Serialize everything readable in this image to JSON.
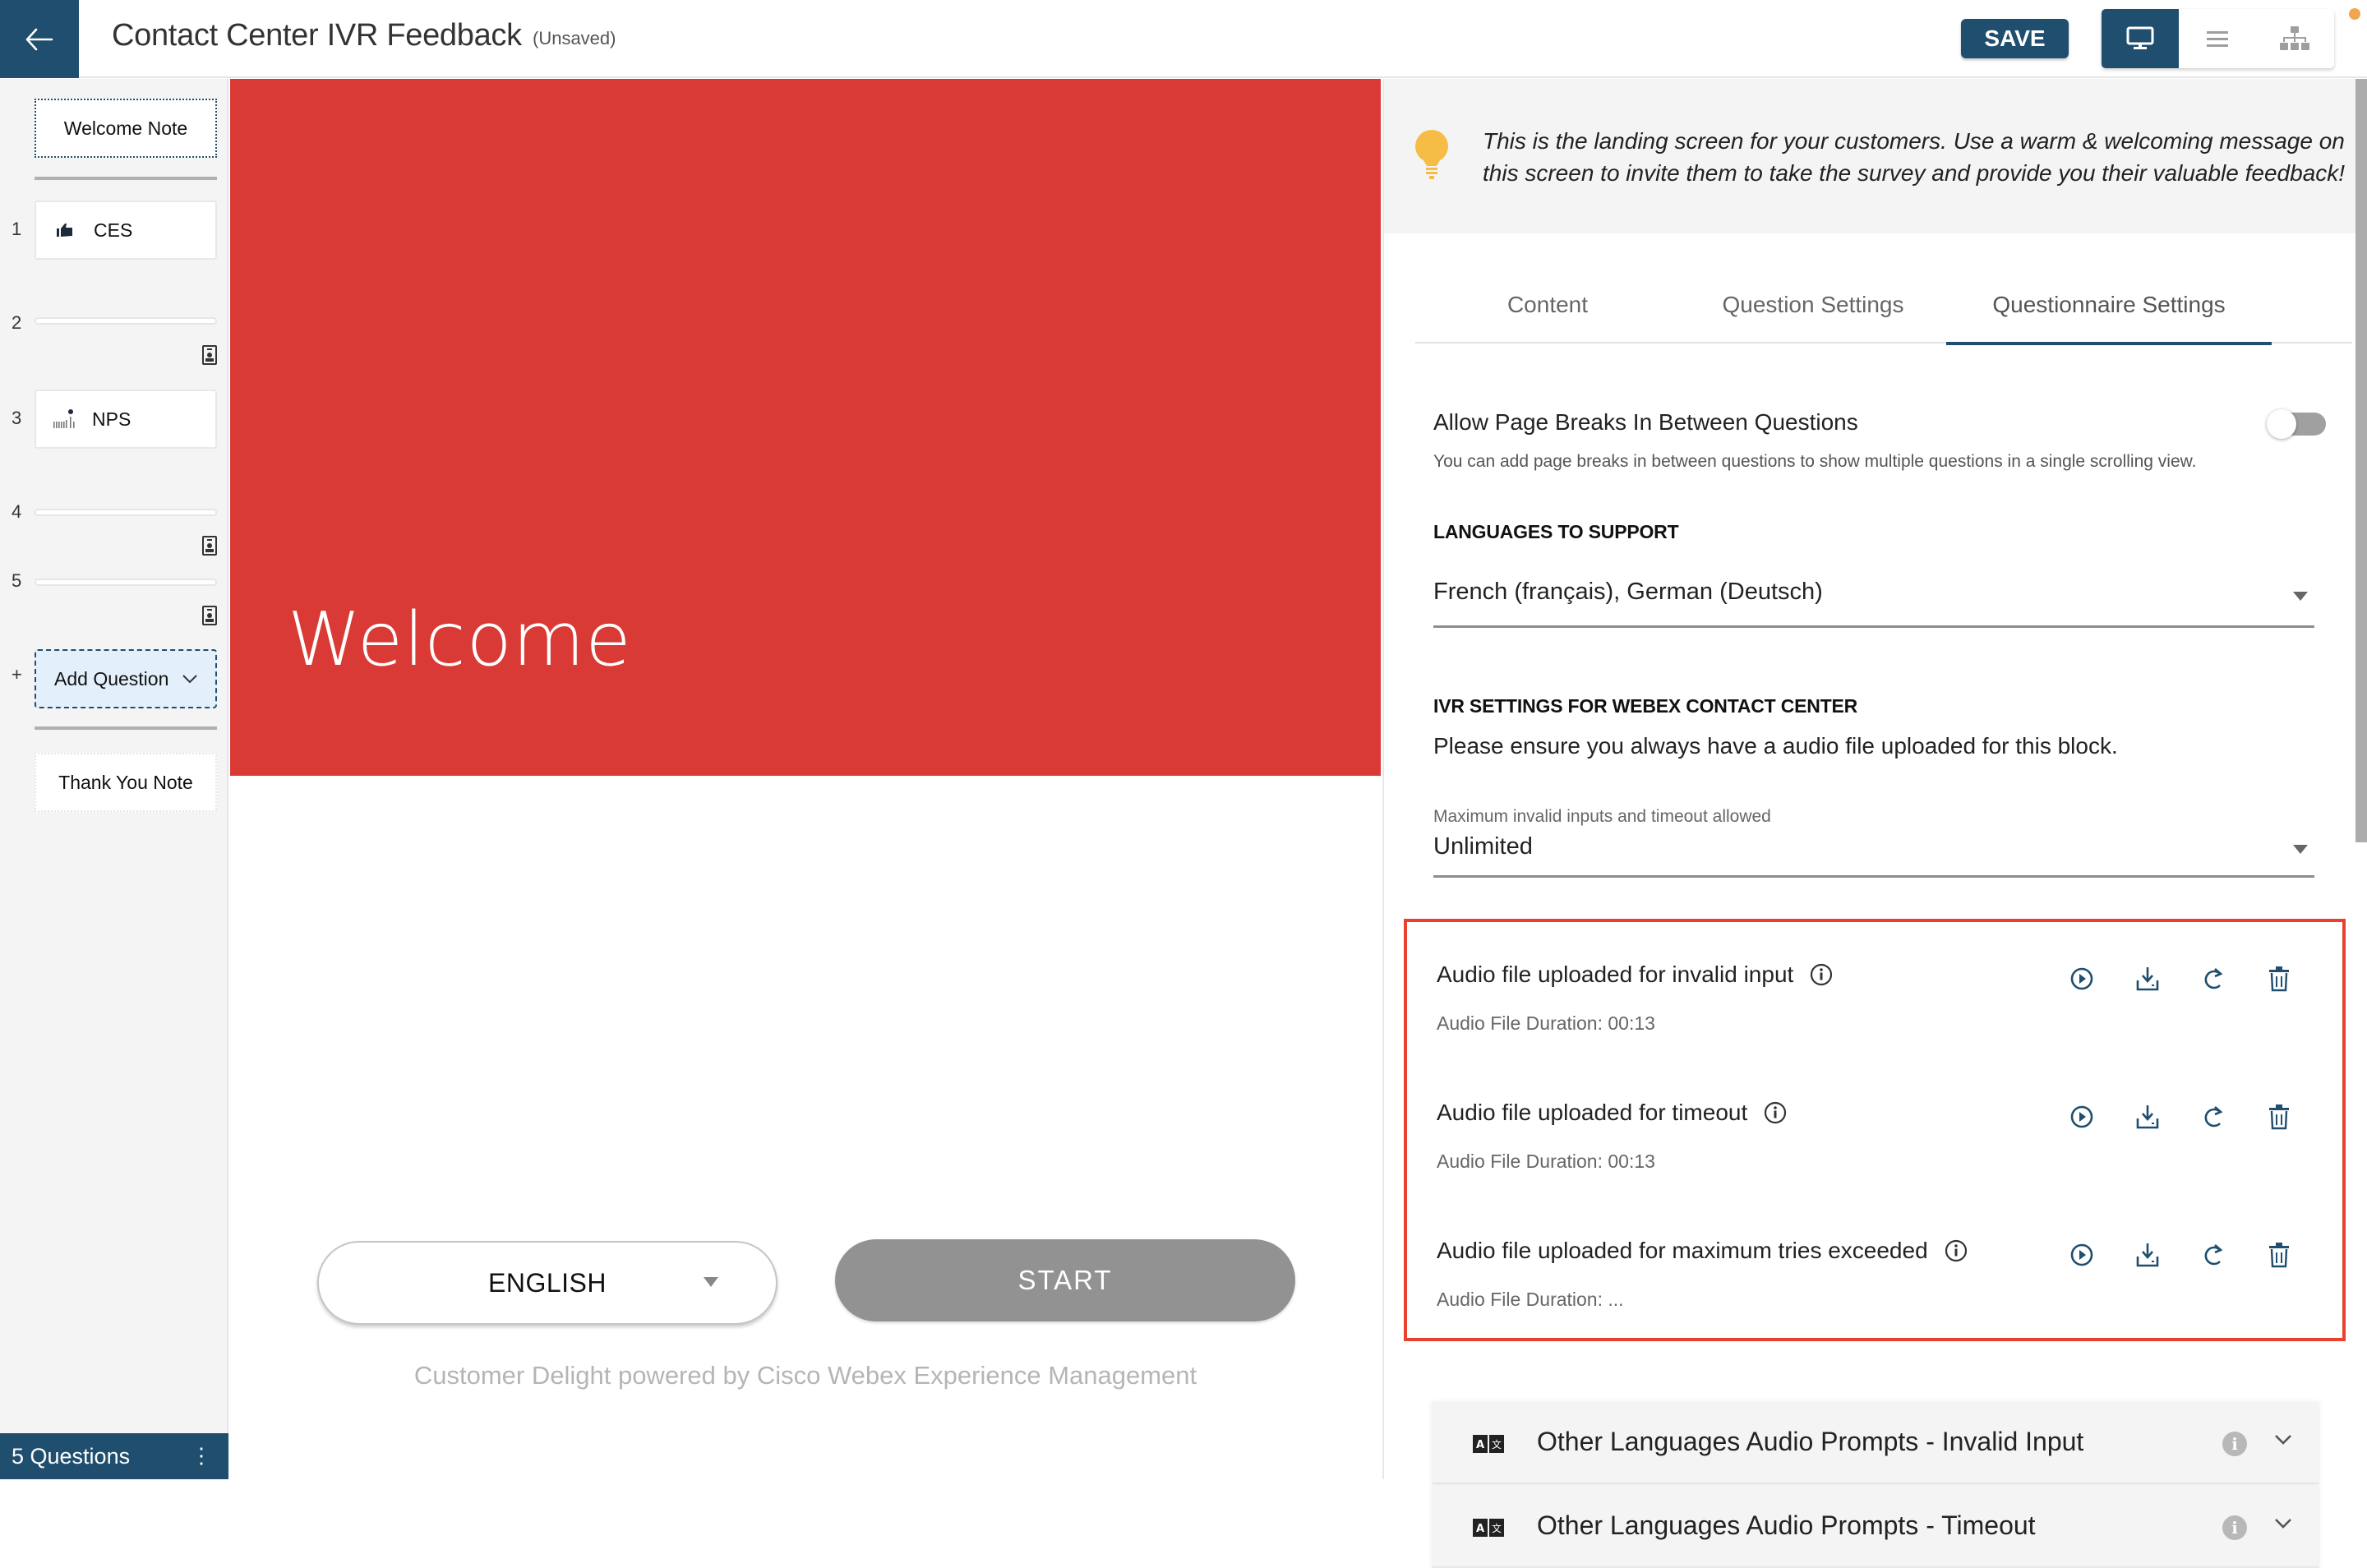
{
  "header": {
    "back_label": "Back",
    "title": "Contact Center IVR Feedback",
    "status": "(Unsaved)",
    "save_label": "SAVE",
    "views": [
      {
        "name": "desktop-preview",
        "icon": "monitor-icon",
        "active": true
      },
      {
        "name": "list-view",
        "icon": "list-icon",
        "active": false
      },
      {
        "name": "flow-view",
        "icon": "hierarchy-icon",
        "active": false
      }
    ]
  },
  "sidebar": {
    "welcome_note": "Welcome Note",
    "questions": [
      {
        "number": "1",
        "label": "CES",
        "icon": "thumbs-up-icon"
      },
      {
        "number": "2",
        "label": "",
        "icon": "contact-card-icon"
      },
      {
        "number": "3",
        "label": "NPS",
        "icon": "nps-icon"
      },
      {
        "number": "4",
        "label": "",
        "icon": "contact-card-icon"
      },
      {
        "number": "5",
        "label": "",
        "icon": "contact-card-icon"
      }
    ],
    "add_prefix": "+",
    "add_question": "Add Question",
    "thank_you_note": "Thank You Note",
    "footer": "5 Questions",
    "footer_menu": "⋮"
  },
  "preview": {
    "hero_color": "#d93a35",
    "welcome_title": "Welcome",
    "language": "ENGLISH",
    "start_label": "START",
    "powered_by": "Customer Delight powered by Cisco Webex Experience Management"
  },
  "panel": {
    "tip": "This is the landing screen for your customers. Use a warm & welcoming message on this screen to invite them to take the survey and provide you their valuable feedback!",
    "tabs": [
      {
        "label": "Content",
        "active": false
      },
      {
        "label": "Question Settings",
        "active": false
      },
      {
        "label": "Questionnaire Settings",
        "active": true
      }
    ],
    "page_breaks": {
      "title": "Allow Page Breaks In Between Questions",
      "description": "You can add page breaks in between questions to show multiple questions in a single scrolling view.",
      "enabled": false
    },
    "languages": {
      "heading": "LANGUAGES TO SUPPORT",
      "value": "French (français), German (Deutsch)"
    },
    "ivr": {
      "heading": "IVR SETTINGS FOR WEBEX CONTACT CENTER",
      "note": "Please ensure you always have a audio file uploaded for this block.",
      "max_label": "Maximum invalid inputs and timeout allowed",
      "max_value": "Unlimited"
    },
    "audio_files": [
      {
        "title": "Audio file uploaded for invalid input",
        "duration": "Audio File Duration: 00:13"
      },
      {
        "title": "Audio file uploaded for timeout",
        "duration": "Audio File Duration: 00:13"
      },
      {
        "title": "Audio file uploaded for maximum tries exceeded",
        "duration": "Audio File Duration: ..."
      }
    ],
    "highlight_color": "#e8412e",
    "accordions": [
      {
        "title": "Other Languages Audio Prompts - Invalid Input",
        "info": "i"
      },
      {
        "title": "Other Languages Audio Prompts - Timeout",
        "info": "i"
      }
    ]
  },
  "colors": {
    "brand": "#1f4e6e",
    "tip_bulb": "#f5bd45",
    "notification": "#f0a650"
  }
}
